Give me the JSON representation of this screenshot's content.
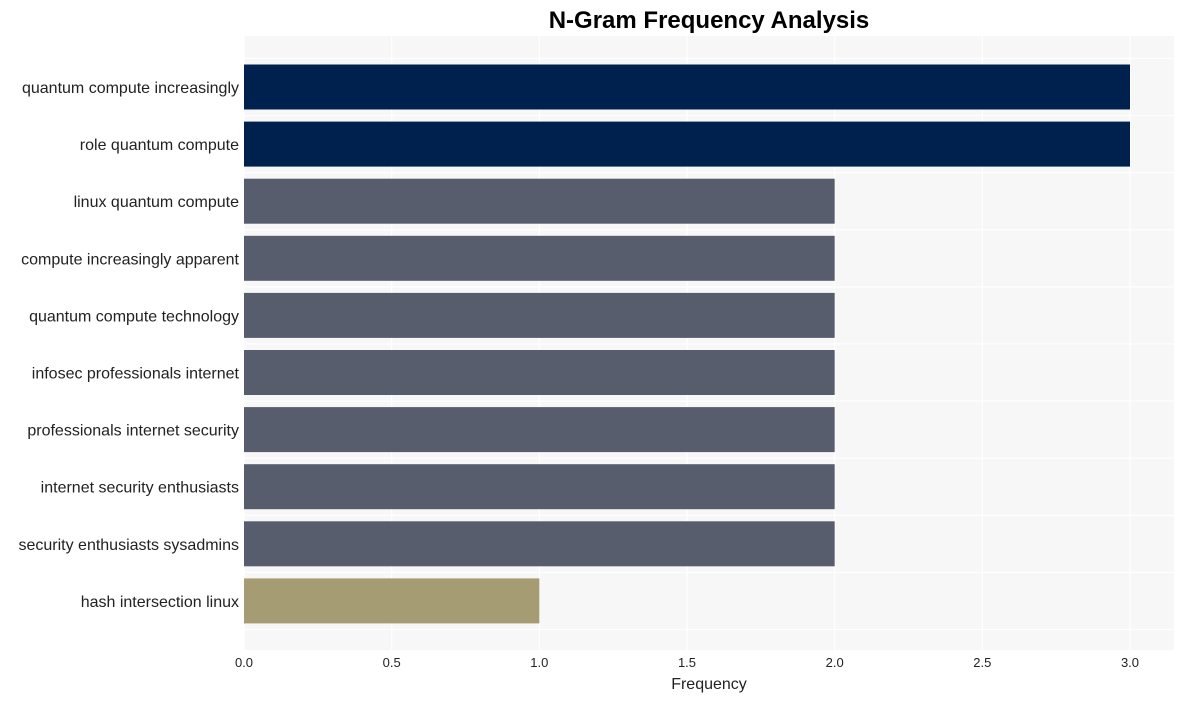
{
  "chart_data": {
    "type": "bar",
    "orientation": "horizontal",
    "title": "N-Gram Frequency Analysis",
    "xlabel": "Frequency",
    "ylabel": "",
    "xlim": [
      0,
      3.15
    ],
    "xticks": [
      0.0,
      0.5,
      1.0,
      1.5,
      2.0,
      2.5,
      3.0
    ],
    "xtick_labels": [
      "0.0",
      "0.5",
      "1.0",
      "1.5",
      "2.0",
      "2.5",
      "3.0"
    ],
    "grid": true,
    "legend": "none",
    "categories": [
      "quantum compute increasingly",
      "role quantum compute",
      "linux quantum compute",
      "compute increasingly apparent",
      "quantum compute technology",
      "infosec professionals internet",
      "professionals internet security",
      "internet security enthusiasts",
      "security enthusiasts sysadmins",
      "hash intersection linux"
    ],
    "values": [
      3,
      3,
      2,
      2,
      2,
      2,
      2,
      2,
      2,
      1
    ],
    "colors": {
      "3": "#00204e",
      "2": "#575d6d",
      "1": "#a69c73"
    },
    "background": "#f7f7f7",
    "gridline_color": "#ffffff"
  }
}
